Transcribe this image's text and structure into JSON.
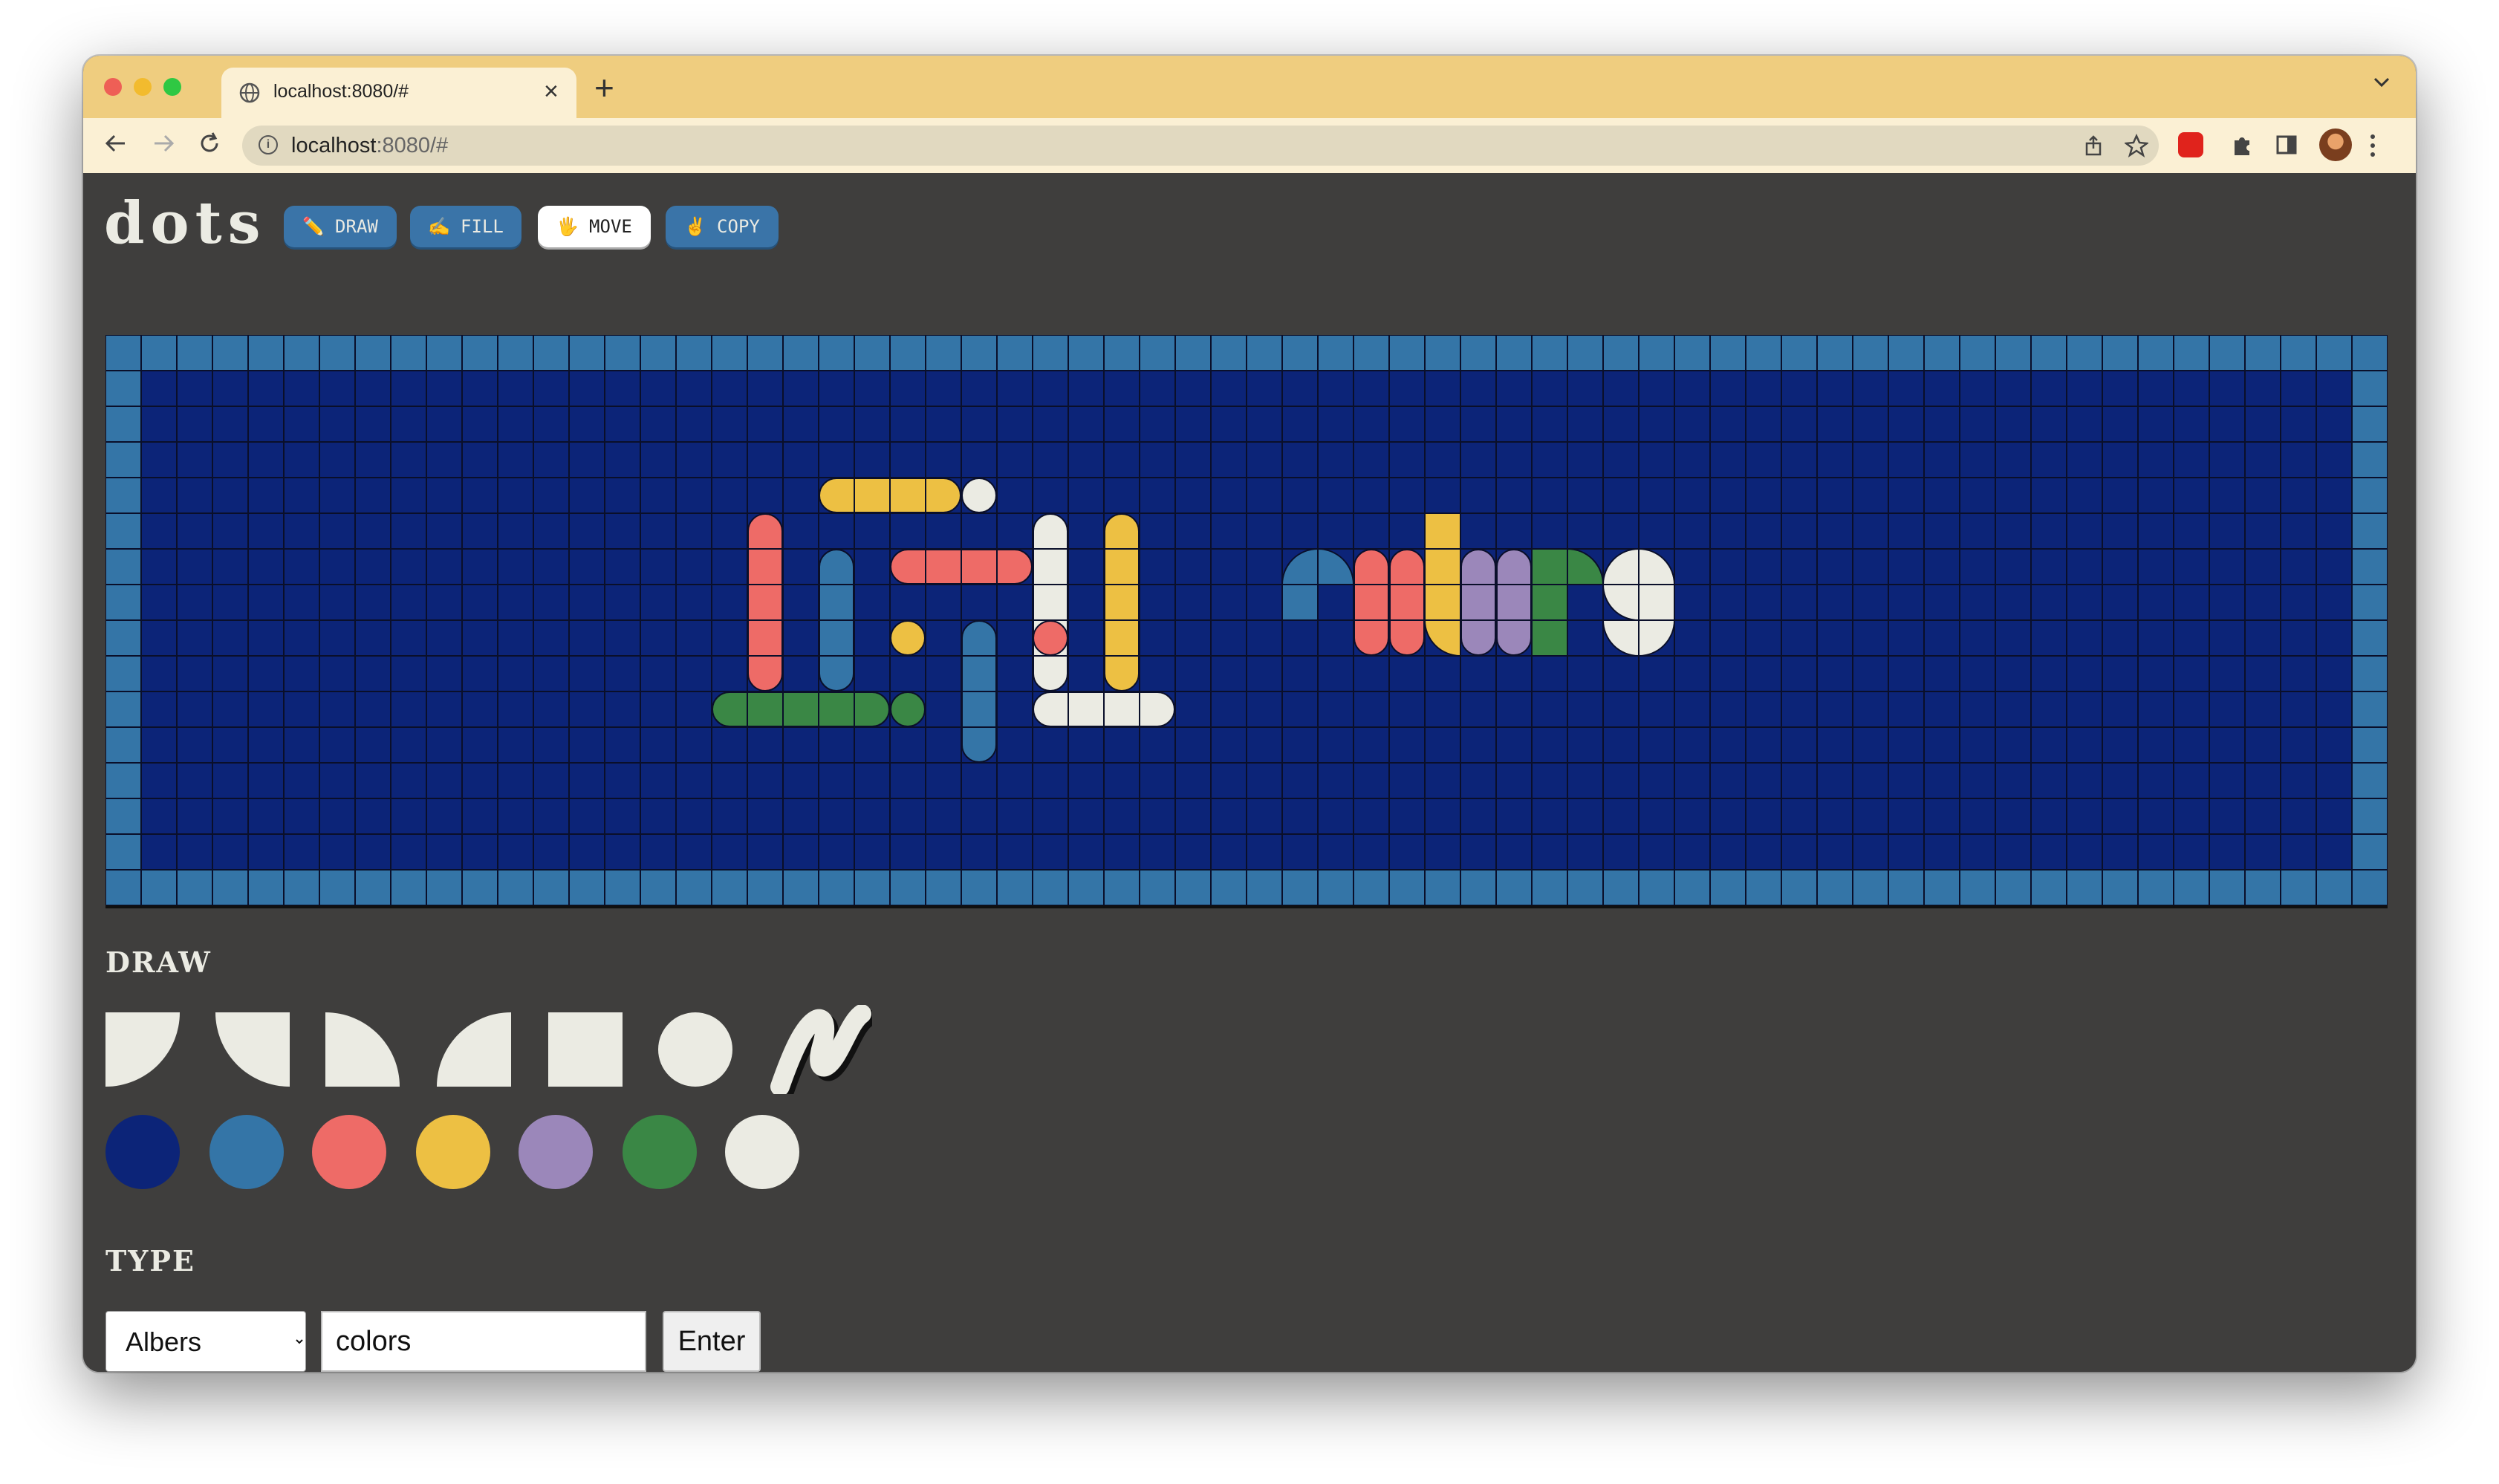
{
  "browser": {
    "tab_title": "localhost:8080/#",
    "url_host": "localhost",
    "url_rest": ":8080/#",
    "new_tab": "+",
    "tab_close": "×"
  },
  "app": {
    "logo": "dots",
    "modes": [
      {
        "emoji": "✏️",
        "label": "DRAW",
        "active": false
      },
      {
        "emoji": "✍️",
        "label": "FILL",
        "active": false
      },
      {
        "emoji": "🖐",
        "label": "MOVE",
        "active": true
      },
      {
        "emoji": "✌️",
        "label": "COPY",
        "active": false
      }
    ],
    "draw_heading": "DRAW",
    "type_heading": "TYPE",
    "shapes": [
      "quarter-bottom-left",
      "quarter-bottom-right",
      "quarter-top-left",
      "quarter-top-right",
      "square",
      "circle",
      "freehand"
    ],
    "palette": {
      "navy": "#0c2478",
      "blue": "#3475a7",
      "red": "#ee6b67",
      "yellow": "#edc043",
      "purple": "#9b87ba",
      "green": "#3a8745",
      "white": "#ebebe3"
    },
    "font_select_value": "Albers",
    "type_value": "colors",
    "enter_label": "Enter"
  }
}
